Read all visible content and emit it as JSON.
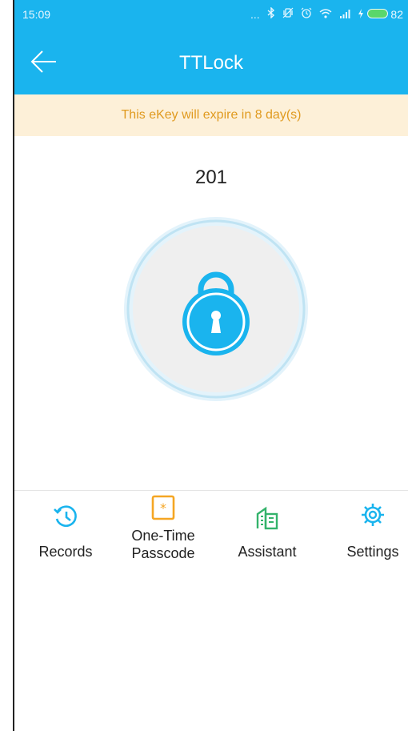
{
  "status_bar": {
    "time": "15:09",
    "indicators": "...",
    "battery": "82"
  },
  "header": {
    "title": "TTLock",
    "back_icon": "arrow-left-icon"
  },
  "banner": {
    "text": "This eKey will expire in 8 day(s)"
  },
  "lock": {
    "name": "201",
    "icon": "padlock-icon"
  },
  "actions": [
    {
      "label": "Records",
      "icon": "history-icon",
      "color": "#1ab4ee"
    },
    {
      "label": "One-Time\nPasscode",
      "icon": "passcode-icon",
      "color": "#f5a623"
    },
    {
      "label": "Assistant",
      "icon": "building-icon",
      "color": "#34b36b"
    },
    {
      "label": "Settings",
      "icon": "gear-icon",
      "color": "#1ab4ee"
    }
  ],
  "colors": {
    "primary": "#1ab4ee",
    "banner_bg": "#fdf0d8",
    "banner_text": "#e09a1f"
  }
}
